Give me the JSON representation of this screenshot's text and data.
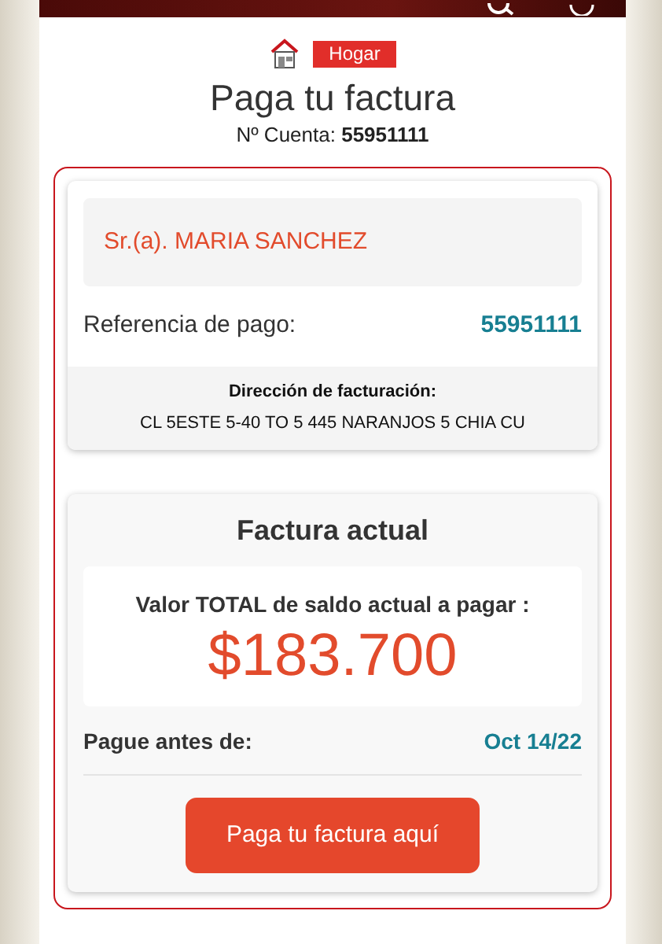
{
  "category": {
    "label": "Hogar"
  },
  "title": "Paga tu factura",
  "account": {
    "label": "Nº Cuenta:",
    "number": "55951111"
  },
  "customer": {
    "name": "Sr.(a). MARIA SANCHEZ",
    "reference_label": "Referencia de pago:",
    "reference": "55951111",
    "address_label": "Dirección de facturación:",
    "address": "CL 5ESTE 5-40 TO 5 445 NARANJOS 5 CHIA CU"
  },
  "bill": {
    "title": "Factura actual",
    "total_label": "Valor TOTAL de saldo actual a pagar :",
    "amount": "$183.700",
    "due_label": "Pague antes de:",
    "due_date": "Oct 14/22",
    "pay_button": "Paga tu factura aquí"
  }
}
